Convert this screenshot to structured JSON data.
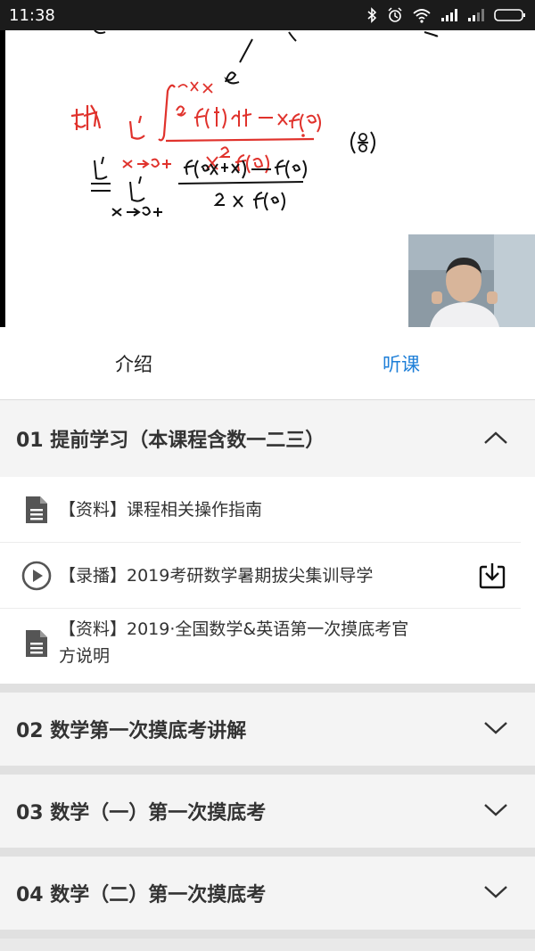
{
  "status_bar": {
    "time": "11:38"
  },
  "tabs": [
    {
      "label": "介绍",
      "active": false
    },
    {
      "label": "听课",
      "active": true
    }
  ],
  "colors": {
    "accent": "#1e7fd8",
    "formula_red": "#e0322c",
    "ink": "#111111"
  },
  "chapters": [
    {
      "title": "01 提前学习（本课程含数一二三）",
      "expanded": true,
      "icon": "chevron-up-icon",
      "items": [
        {
          "type": "doc",
          "icon": "document-icon",
          "text": "【资料】课程相关操作指南"
        },
        {
          "type": "video",
          "icon": "play-circle-icon",
          "text": "【录播】2019考研数学暑期拔尖集训导学",
          "download": "download-icon"
        },
        {
          "type": "doc",
          "icon": "document-icon",
          "text": "【资料】2019·全国数学&英语第一次摸底考官方说明"
        }
      ]
    },
    {
      "title": "02 数学第一次摸底考讲解",
      "expanded": false,
      "icon": "chevron-down-icon"
    },
    {
      "title": "03 数学（一）第一次摸底考",
      "expanded": false,
      "icon": "chevron-down-icon"
    },
    {
      "title": "04 数学（二）第一次摸底考",
      "expanded": false,
      "icon": "chevron-down-icon"
    }
  ]
}
